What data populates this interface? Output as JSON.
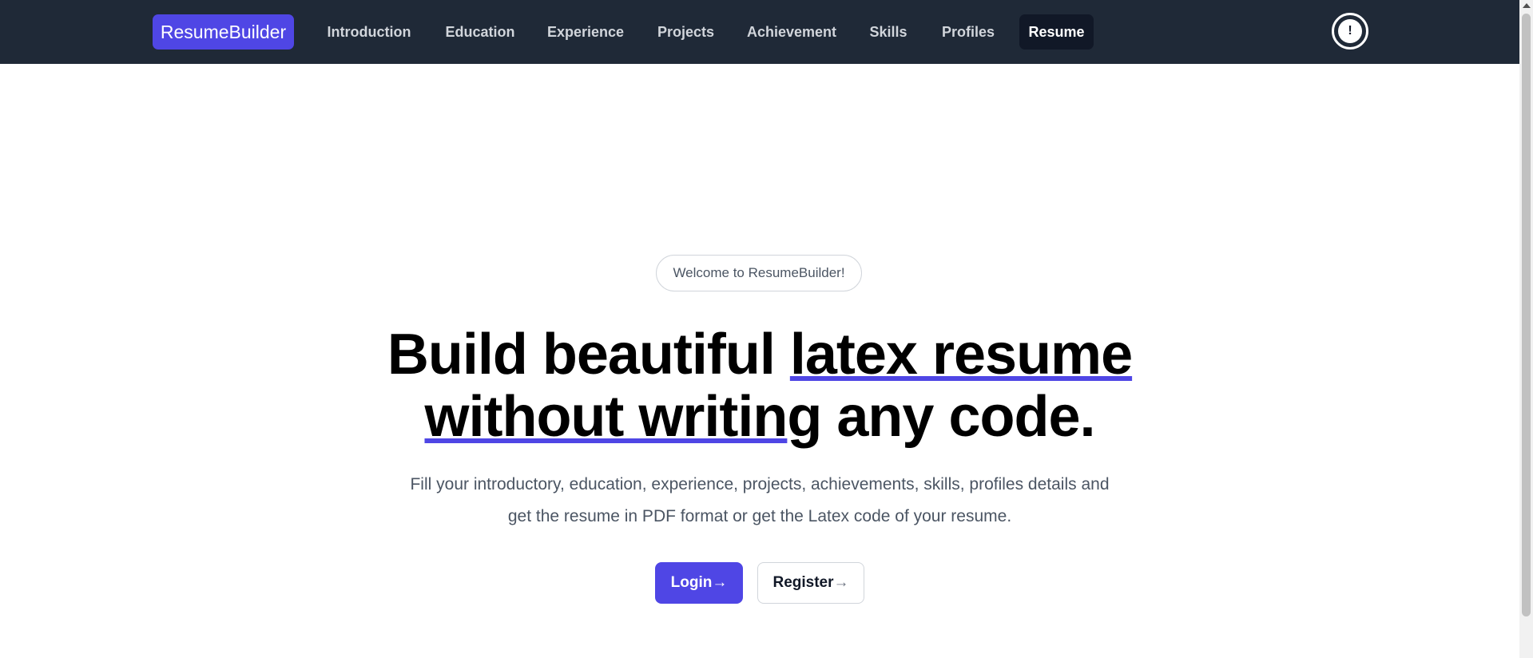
{
  "navbar": {
    "brand": "ResumeBuilder",
    "items": [
      {
        "label": "Introduction"
      },
      {
        "label": "Education"
      },
      {
        "label": "Experience"
      },
      {
        "label": "Projects"
      },
      {
        "label": "Achievement"
      },
      {
        "label": "Skills"
      },
      {
        "label": "Profiles"
      },
      {
        "label": "Resume",
        "active": true
      }
    ],
    "alert_icon": "exclamation-circle-icon",
    "alert_glyph": "!"
  },
  "hero": {
    "badge": "Welcome to ResumeBuilder!",
    "headline": {
      "part1": "Build beautiful ",
      "highlight1": "latex resume",
      "highlight2": "without writin",
      "part2": "g any code."
    },
    "subtext_line1": "Fill your introductory, education, experience, projects, achievements, skills, profiles details and",
    "subtext_line2": "get the resume in PDF format or get the Latex code of your resume.",
    "login_label": "Login",
    "register_label": "Register",
    "arrow": "→"
  },
  "colors": {
    "navbar_bg": "#1f2937",
    "accent": "#4f46e5",
    "active_nav_bg": "#111827"
  }
}
